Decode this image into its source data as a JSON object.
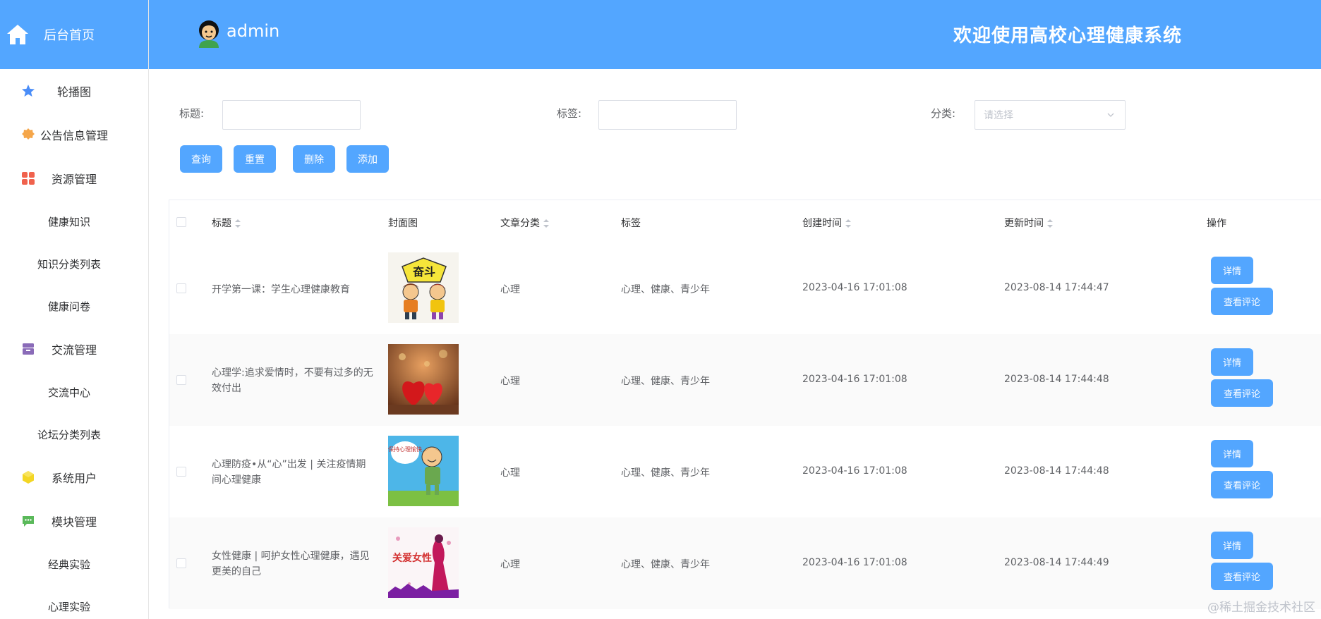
{
  "sidebar": {
    "brand": "后台首页",
    "items": [
      {
        "label": "轮播图",
        "icon": "star-icon"
      },
      {
        "label": "公告信息管理",
        "icon": "badge-icon"
      },
      {
        "label": "资源管理",
        "icon": "grid-icon"
      },
      {
        "label": "健康知识"
      },
      {
        "label": "知识分类列表"
      },
      {
        "label": "健康问卷"
      },
      {
        "label": "交流管理",
        "icon": "archive-icon"
      },
      {
        "label": "交流中心"
      },
      {
        "label": "论坛分类列表"
      },
      {
        "label": "系统用户",
        "icon": "cube-icon"
      },
      {
        "label": "模块管理",
        "icon": "chat-icon"
      },
      {
        "label": "经典实验"
      },
      {
        "label": "心理实验"
      }
    ]
  },
  "header": {
    "username": "admin",
    "welcome": "欢迎使用高校心理健康系统"
  },
  "search": {
    "title_label": "标题:",
    "tag_label": "标签:",
    "category_label": "分类:",
    "category_placeholder": "请选择",
    "buttons": {
      "query": "查询",
      "reset": "重置",
      "delete": "删除",
      "add": "添加"
    }
  },
  "table": {
    "columns": {
      "title": "标题",
      "cover": "封面图",
      "category": "文章分类",
      "tags": "标签",
      "created": "创建时间",
      "updated": "更新时间",
      "actions": "操作"
    },
    "rows": [
      {
        "title": "开学第一课：学生心理健康教育",
        "category": "心理",
        "tags": "心理、健康、青少年",
        "created": "2023-04-16 17:01:08",
        "updated": "2023-08-14 17:44:47",
        "cover_text": "奋斗"
      },
      {
        "title": "心理学:追求爱情时，不要有过多的无效付出",
        "category": "心理",
        "tags": "心理、健康、青少年",
        "created": "2023-04-16 17:01:08",
        "updated": "2023-08-14 17:44:48"
      },
      {
        "title": "心理防疫•从“心”出发 | 关注疫情期间心理健康",
        "category": "心理",
        "tags": "心理、健康、青少年",
        "created": "2023-04-16 17:01:08",
        "updated": "2023-08-14 17:44:48",
        "cover_text": "保持心理愉快"
      },
      {
        "title": "女性健康 | 呵护女性心理健康，遇见更美的自己",
        "category": "心理",
        "tags": "心理、健康、青少年",
        "created": "2023-04-16 17:01:08",
        "updated": "2023-08-14 17:44:49",
        "cover_text": "关爱女性"
      }
    ],
    "detail_label": "详情",
    "comment_label": "查看评论"
  },
  "watermark": "@稀土掘金技术社区",
  "colors": {
    "primary": "#53a6ff",
    "border": "#dcdfe6"
  }
}
